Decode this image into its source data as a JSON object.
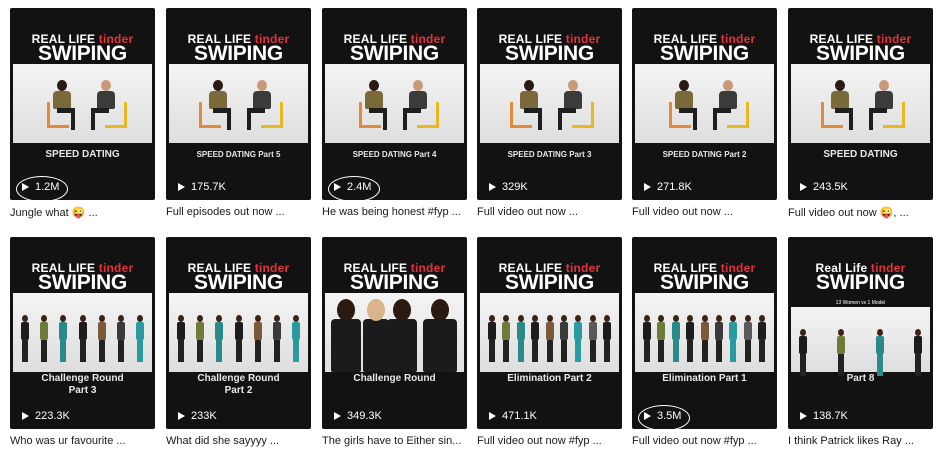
{
  "row1": [
    {
      "line1": "REAL LIFE",
      "tinder": "tinder",
      "line2": "SWIPING",
      "caption": "SPEED DATING",
      "views": "1.2M",
      "desc": "Jungle what 😜 ...",
      "circled": true
    },
    {
      "line1": "REAL LIFE",
      "tinder": "tinder",
      "line2": "SWIPING",
      "caption": "SPEED DATING Part 5",
      "views": "175.7K",
      "desc": "Full episodes out now ...",
      "circled": false
    },
    {
      "line1": "REAL LIFE",
      "tinder": "tinder",
      "line2": "SWIPING",
      "caption": "SPEED DATING Part 4",
      "views": "2.4M",
      "desc": "He was being honest #fyp ...",
      "circled": true
    },
    {
      "line1": "REAL LIFE",
      "tinder": "tinder",
      "line2": "SWIPING",
      "caption": "SPEED DATING Part 3",
      "views": "329K",
      "desc": "Full video out now ...",
      "circled": false
    },
    {
      "line1": "REAL LIFE",
      "tinder": "tinder",
      "line2": "SWIPING",
      "caption": "SPEED DATING Part 2",
      "views": "271.8K",
      "desc": "Full video out now ...",
      "circled": false
    },
    {
      "line1": "REAL LIFE",
      "tinder": "tinder",
      "line2": "SWIPING",
      "caption": "SPEED DATING",
      "views": "243.5K",
      "desc": "Full video out now 😜, ...",
      "circled": false
    }
  ],
  "row2": [
    {
      "line1": "REAL LIFE",
      "tinder": "tinder",
      "line2": "SWIPING",
      "caption": "Challenge Round",
      "caption2": "Part 3",
      "views": "223.3K",
      "desc": "Who was ur favourite ...",
      "circled": false
    },
    {
      "line1": "REAL LIFE",
      "tinder": "tinder",
      "line2": "SWIPING",
      "caption": "Challenge Round",
      "caption2": "Part 2",
      "views": "233K",
      "desc": "What did she sayyyy ...",
      "circled": false
    },
    {
      "line1": "REAL LIFE",
      "tinder": "tinder",
      "line2": "SWIPING",
      "caption": "Challenge Round",
      "caption2": "",
      "views": "349.3K",
      "desc": "The girls have to Either sin...",
      "circled": false
    },
    {
      "line1": "REAL LIFE",
      "tinder": "tinder",
      "line2": "SWIPING",
      "caption": "Elimination Part 2",
      "caption2": "",
      "views": "471.1K",
      "desc": "Full video out now #fyp ...",
      "circled": false
    },
    {
      "line1": "REAL LIFE",
      "tinder": "tinder",
      "line2": "SWIPING",
      "caption": "Elimination Part 1",
      "caption2": "",
      "views": "3.5M",
      "desc": "Full video out now #fyp ...",
      "circled": true
    },
    {
      "line1": "Real Life",
      "tinder": "tinder",
      "line2": "SWIPING",
      "subtitle": "13 Women vs 1 Model",
      "caption": "Part 8",
      "caption2": "",
      "views": "138.7K",
      "desc": "I think Patrick likes Ray ...",
      "circled": false
    }
  ],
  "colors": {
    "accent_red": "#e0333f",
    "thumb_bg": "#121212",
    "chair_orange": "#e08a3a",
    "chair_yellow": "#e8b820"
  }
}
